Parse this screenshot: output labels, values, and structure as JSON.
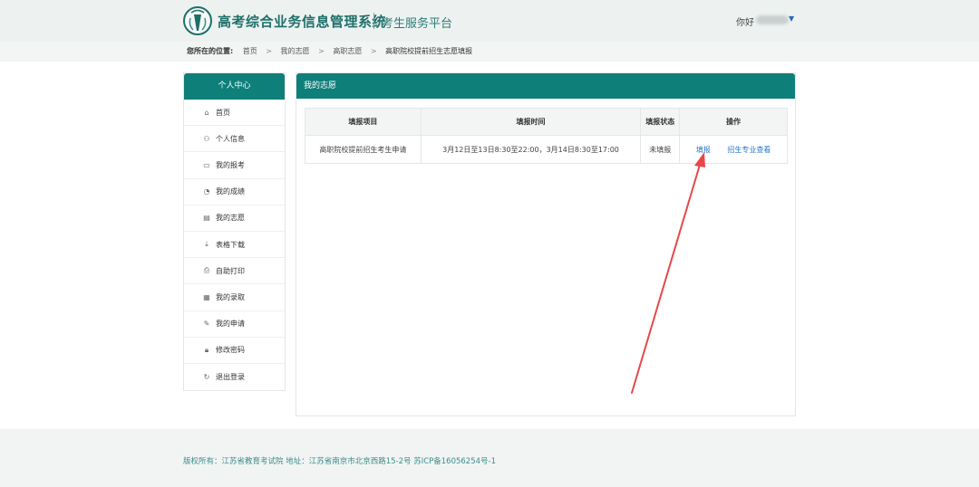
{
  "header": {
    "system_title": "高考综合业务信息管理系统",
    "platform_label": "考生服务平台",
    "greeting": "你好"
  },
  "breadcrumb": {
    "lead": "您所在的位置:",
    "items": [
      "首页",
      "我的志愿",
      "高职志愿",
      "高职院校提前招生志愿填报"
    ]
  },
  "sidebar": {
    "title": "个人中心",
    "items": [
      {
        "label": "首页",
        "icon": "home-icon"
      },
      {
        "label": "个人信息",
        "icon": "user-icon"
      },
      {
        "label": "我的报考",
        "icon": "id-card-icon"
      },
      {
        "label": "我的成绩",
        "icon": "pie-chart-icon"
      },
      {
        "label": "我的志愿",
        "icon": "document-icon"
      },
      {
        "label": "表格下载",
        "icon": "download-icon"
      },
      {
        "label": "自助打印",
        "icon": "printer-icon"
      },
      {
        "label": "我的录取",
        "icon": "calendar-icon"
      },
      {
        "label": "我的申请",
        "icon": "edit-icon"
      },
      {
        "label": "修改密码",
        "icon": "lock-icon"
      },
      {
        "label": "退出登录",
        "icon": "logout-icon"
      }
    ]
  },
  "panel": {
    "title": "我的志愿",
    "columns": [
      "填报项目",
      "填报时间",
      "填报状态",
      "操作"
    ],
    "rows": [
      {
        "project": "高职院校提前招生考生申请",
        "time": "3月12日至13日8:30至22:00，3月14日8:30至17:00",
        "status": "未填报",
        "actions": [
          "填报",
          "招生专业查看"
        ]
      }
    ]
  },
  "footer": {
    "text": "版权所有：江苏省教育考试院 地址：江苏省南京市北京西路15-2号 苏ICP备16056254号-1"
  },
  "colors": {
    "brand": "#0f7f7a",
    "status_red": "#e04a4a",
    "link": "#2b78c7",
    "annotation_arrow": "#e8474a"
  }
}
